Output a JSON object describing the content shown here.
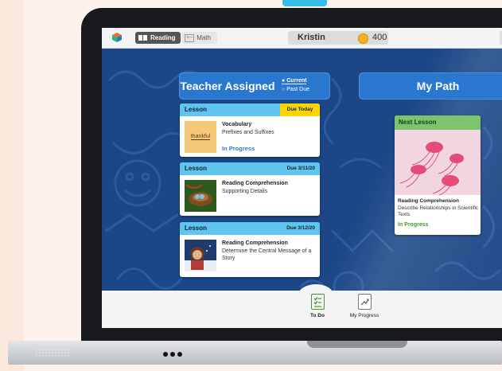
{
  "topbar": {
    "subject_reading": "Reading",
    "subject_math": "Math",
    "user_name": "Kristin",
    "coins": "400"
  },
  "teacher_assigned": {
    "title": "Teacher Assigned",
    "legend_current": "Current",
    "legend_past_due": "Past Due",
    "lessons": [
      {
        "type": "Lesson",
        "due": "Due Today",
        "subject": "Vocabulary",
        "topic": "Prefixes and Suffixes",
        "status": "In Progress",
        "thumb_word": "thankful"
      },
      {
        "type": "Lesson",
        "due": "Due 3/11/20",
        "subject": "Reading Comprehension",
        "topic": "Supporting Details"
      },
      {
        "type": "Lesson",
        "due": "Due 3/12/20",
        "subject": "Reading Comprehension",
        "topic": "Determine the Central Message of a Story"
      }
    ]
  },
  "my_path": {
    "title": "My Path",
    "next_lesson": {
      "label": "Next Lesson",
      "subject": "Reading Comprehension",
      "topic": "Describe Relationships in Scientific Texts",
      "status": "In Progress"
    }
  },
  "bottom_nav": {
    "todo": "To Do",
    "progress": "My Progress"
  },
  "colors": {
    "screen_bg": "#1b4786",
    "header_blue": "#2a77d0",
    "card_header": "#5fc4ee",
    "due_today": "#ffd400",
    "next_lesson_green": "#7dc46e"
  }
}
